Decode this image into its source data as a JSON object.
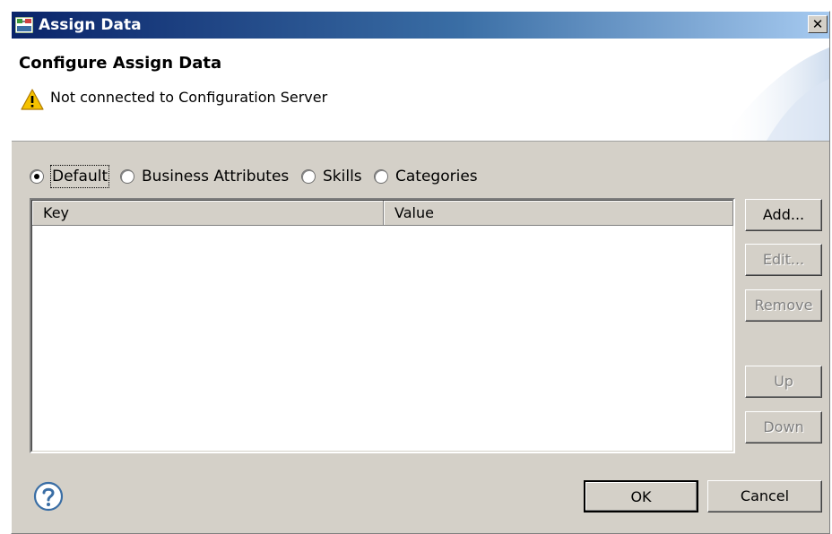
{
  "window": {
    "title": "Assign Data",
    "close_glyph": "✕"
  },
  "header": {
    "title": "Configure Assign Data",
    "message": "Not connected to Configuration Server",
    "message_icon": "warning-icon"
  },
  "scope_options": {
    "selected": "Default",
    "items": [
      {
        "label": "Default",
        "checked": true
      },
      {
        "label": "Business Attributes",
        "checked": false
      },
      {
        "label": "Skills",
        "checked": false
      },
      {
        "label": "Categories",
        "checked": false
      }
    ]
  },
  "table": {
    "columns": [
      {
        "label": "Key"
      },
      {
        "label": "Value"
      }
    ],
    "rows": []
  },
  "side_buttons": {
    "add": {
      "label": "Add...",
      "enabled": true
    },
    "edit": {
      "label": "Edit...",
      "enabled": false
    },
    "remove": {
      "label": "Remove",
      "enabled": false
    },
    "up": {
      "label": "Up",
      "enabled": false
    },
    "down": {
      "label": "Down",
      "enabled": false
    }
  },
  "footer": {
    "help_icon": "help-icon",
    "ok_label": "OK",
    "cancel_label": "Cancel"
  },
  "colors": {
    "titlebar_start": "#0a246a",
    "titlebar_end": "#a6caf0",
    "dialog_bg": "#d4d0c8",
    "warning": "#f5c200",
    "help_blue": "#3a6ea5"
  }
}
